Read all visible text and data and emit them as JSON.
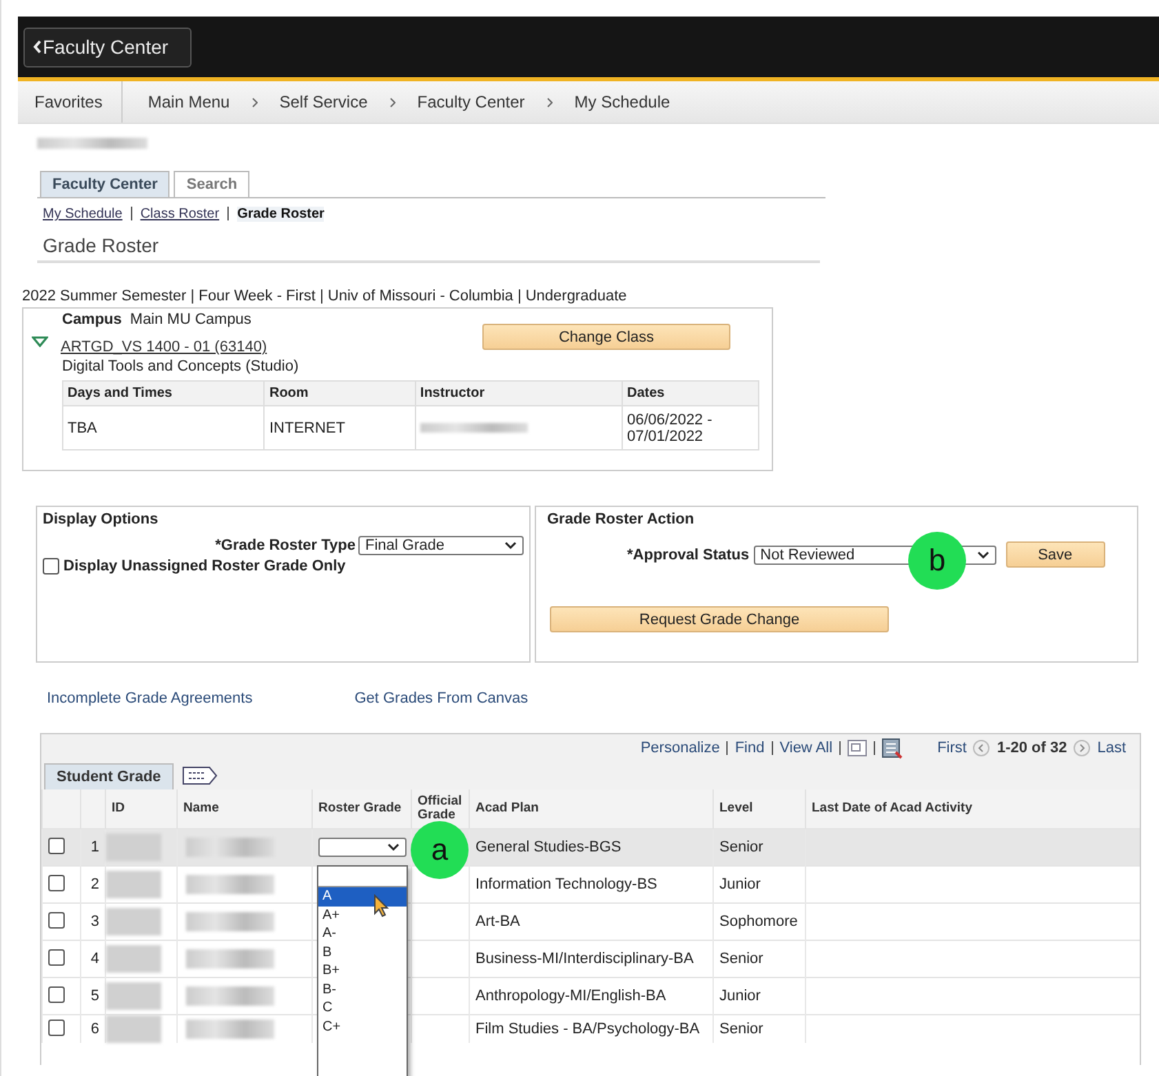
{
  "header": {
    "back_button": "Faculty Center"
  },
  "breadcrumbs": {
    "favorites": "Favorites",
    "main_menu": "Main Menu",
    "items": [
      "Self Service",
      "Faculty Center",
      "My Schedule"
    ]
  },
  "page_tabs": [
    {
      "label": "Faculty Center",
      "selected": true
    },
    {
      "label": "Search",
      "selected": false
    }
  ],
  "sub_links": [
    {
      "label": "My Schedule",
      "selected": false
    },
    {
      "label": "Class Roster",
      "selected": false
    },
    {
      "label": "Grade Roster",
      "selected": true
    }
  ],
  "section_title": "Grade Roster",
  "term": "2022 Summer Semester | Four Week - First | Univ of Missouri - Columbia | Undergraduate",
  "class_info": {
    "campus_label": "Campus",
    "campus_value": "Main MU Campus",
    "expanded": true,
    "class_link": "ARTGD_VS 1400 - 01 (63140)",
    "description": "Digital Tools and Concepts (Studio)",
    "change_class_button": "Change Class",
    "columns": [
      "Days and Times",
      "Room",
      "Instructor",
      "Dates"
    ],
    "row": {
      "days": "TBA",
      "room": "INTERNET",
      "dates": "06/06/2022 - 07/01/2022"
    }
  },
  "display_options": {
    "title": "Display Options",
    "roster_type_label": "*Grade Roster Type",
    "roster_type_value": "Final Grade",
    "unassigned_label": "Display Unassigned Roster Grade Only",
    "unassigned_checked": false
  },
  "grade_roster_action": {
    "title": "Grade Roster Action",
    "approval_label": "*Approval Status",
    "approval_value": "Not Reviewed",
    "callout": "b",
    "save_button": "Save",
    "request_button": "Request Grade Change"
  },
  "links": [
    "Incomplete Grade Agreements",
    "Get Grades From Canvas"
  ],
  "grid": {
    "toolbar_links": [
      "Personalize",
      "Find",
      "View All"
    ],
    "first": "First",
    "range": "1-20 of 32",
    "last": "Last",
    "tab": "Student Grade",
    "columns": [
      "ID",
      "Name",
      "Roster Grade",
      "Official Grade",
      "Acad Plan",
      "Level",
      "Last Date of Acad Activity"
    ],
    "callout": "a",
    "rows": [
      {
        "number": "1",
        "acad_plan": "General Studies-BGS",
        "level": "Senior",
        "checked": false,
        "selected": true
      },
      {
        "number": "2",
        "acad_plan": "Information Technology-BS",
        "level": "Junior",
        "checked": false,
        "selected": false
      },
      {
        "number": "3",
        "acad_plan": "Art-BA",
        "level": "Sophomore",
        "checked": false,
        "selected": false
      },
      {
        "number": "4",
        "acad_plan": "Business-MI/Interdisciplinary-BA",
        "level": "Senior",
        "checked": false,
        "selected": false
      },
      {
        "number": "5",
        "acad_plan": "Anthropology-MI/English-BA",
        "level": "Junior",
        "checked": false,
        "selected": false
      },
      {
        "number": "6",
        "acad_plan": "Film Studies - BA/Psychology-BA",
        "level": "Senior",
        "checked": false,
        "selected": false
      }
    ],
    "grade_options": [
      {
        "label": "A",
        "selected": true
      },
      {
        "label": "A+",
        "selected": false
      },
      {
        "label": "A-",
        "selected": false
      },
      {
        "label": "B",
        "selected": false
      },
      {
        "label": "B+",
        "selected": false
      },
      {
        "label": "B-",
        "selected": false
      },
      {
        "label": "C",
        "selected": false
      },
      {
        "label": "C+",
        "selected": false
      }
    ]
  }
}
